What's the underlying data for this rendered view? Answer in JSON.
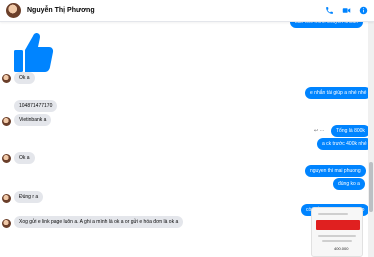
{
  "header": {
    "name": "Nguyễn Thị Phương",
    "top_bubble": "ban nhé mình chuyển khoản"
  },
  "messages": {
    "in_ok_1": "Ok a",
    "out_1": "e nhắn tài giúp a nhé nhé",
    "in_account": "104871477170",
    "in_bank": "Vietinbank a",
    "out_2": "Tổng là 800k",
    "out_3": "a ck trước 400k nhé",
    "in_ok_2": "Ok a",
    "out_4": "nguyen thi mai phuong",
    "out_5": "đúng ko a",
    "in_dung": "Đúng r a",
    "out_6": "còn cần ghi nội dung gì ko",
    "in_long": "Xog gửi e link page luôn a. A ghi a mình là ok a or gửi e hóa đơn là ok a",
    "receipt_amount": "400.000"
  },
  "colors": {
    "accent": "#0084ff",
    "incoming": "#e4e6eb",
    "receipt_red": "#e02020"
  },
  "icons": [
    "phone-icon",
    "video-icon",
    "info-icon",
    "thumbs-up-icon"
  ]
}
